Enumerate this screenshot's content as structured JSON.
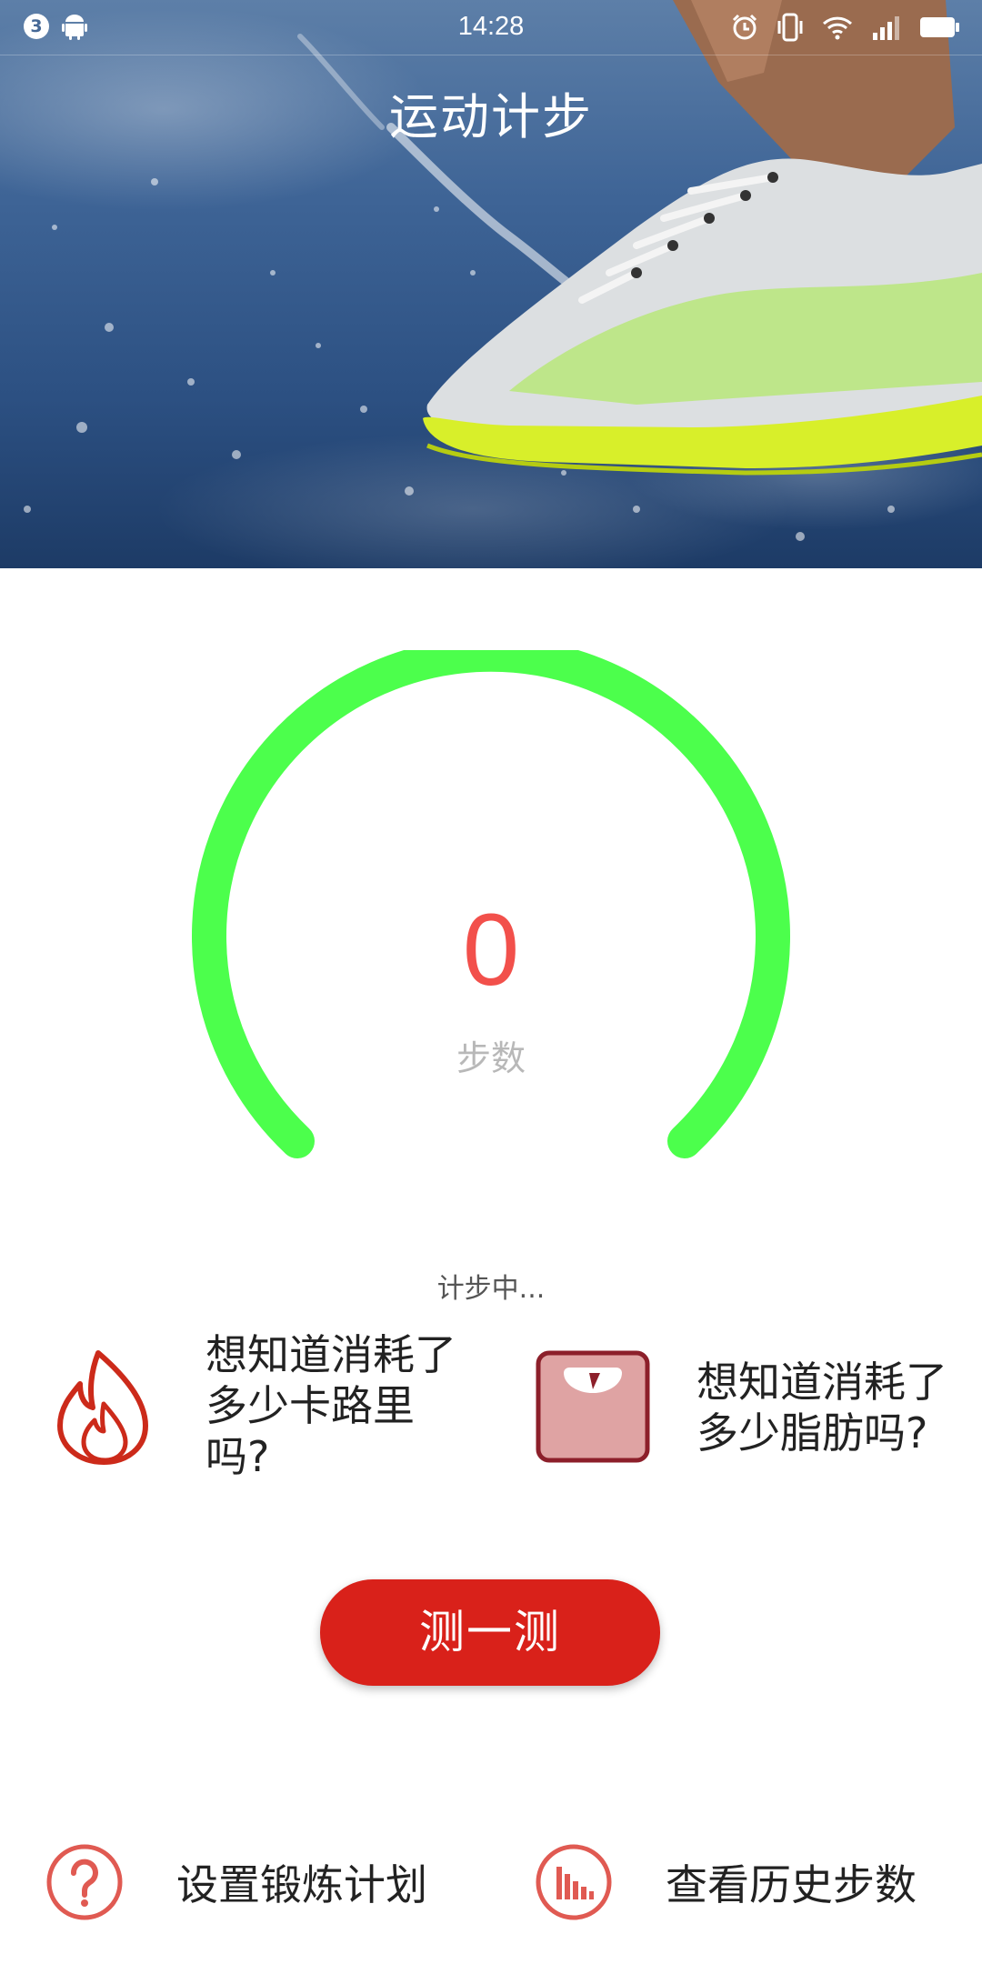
{
  "status_bar": {
    "notification_count": "3",
    "time": "14:28"
  },
  "header": {
    "title": "运动计步"
  },
  "pedometer": {
    "steps": "0",
    "steps_label": "步数",
    "status": "计步中..."
  },
  "cards": {
    "calories_text": [
      "想知道消耗了",
      "多少卡路里",
      "吗?"
    ],
    "fat_text": [
      "想知道消耗了",
      "多少脂肪吗?"
    ]
  },
  "measure_button": "测一测",
  "bottom_nav": {
    "plan_label": "设置锻炼计划",
    "history_label": "查看历史步数"
  },
  "colors": {
    "gauge": "#4cff4c",
    "accent_red": "#d9211a",
    "step_value": "#f2504b"
  },
  "icons": [
    "android-icon",
    "alarm-icon",
    "vibrate-icon",
    "wifi-icon",
    "signal-icon",
    "battery-icon",
    "flame-icon",
    "scale-icon",
    "question-icon",
    "bar-chart-icon"
  ]
}
